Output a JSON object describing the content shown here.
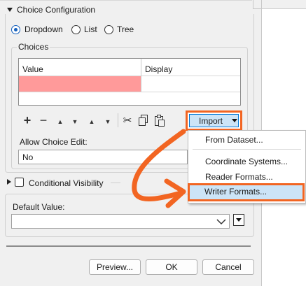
{
  "choice_config": {
    "title": "Choice Configuration",
    "radios": [
      {
        "label": "Dropdown",
        "selected": true
      },
      {
        "label": "List",
        "selected": false
      },
      {
        "label": "Tree",
        "selected": false
      }
    ],
    "choices_label": "Choices",
    "table": {
      "columns": [
        "Value",
        "Display"
      ],
      "rows": [
        {
          "value": "",
          "display": ""
        }
      ]
    },
    "toolbar_icons": [
      "add-icon",
      "remove-icon",
      "move-top-icon",
      "move-up-icon",
      "move-down-icon",
      "move-bottom-icon",
      "cut-icon",
      "copy-icon",
      "paste-icon"
    ],
    "import_label": "Import",
    "allow_edit_label": "Allow Choice Edit:",
    "allow_edit_value": "No"
  },
  "import_menu": {
    "items": [
      "From Dataset...",
      "Coordinate Systems...",
      "Reader Formats...",
      "Writer Formats..."
    ],
    "highlighted": "Writer Formats..."
  },
  "conditional_visibility": {
    "label": "Conditional Visibility",
    "checked": false
  },
  "default_value": {
    "label": "Default Value:",
    "value": ""
  },
  "footer": {
    "preview": "Preview...",
    "ok": "OK",
    "cancel": "Cancel"
  },
  "colors": {
    "annotation": "#f26522",
    "highlight": "#cce4f7",
    "accent": "#1560bd",
    "error_cell": "#ff9a9a"
  }
}
